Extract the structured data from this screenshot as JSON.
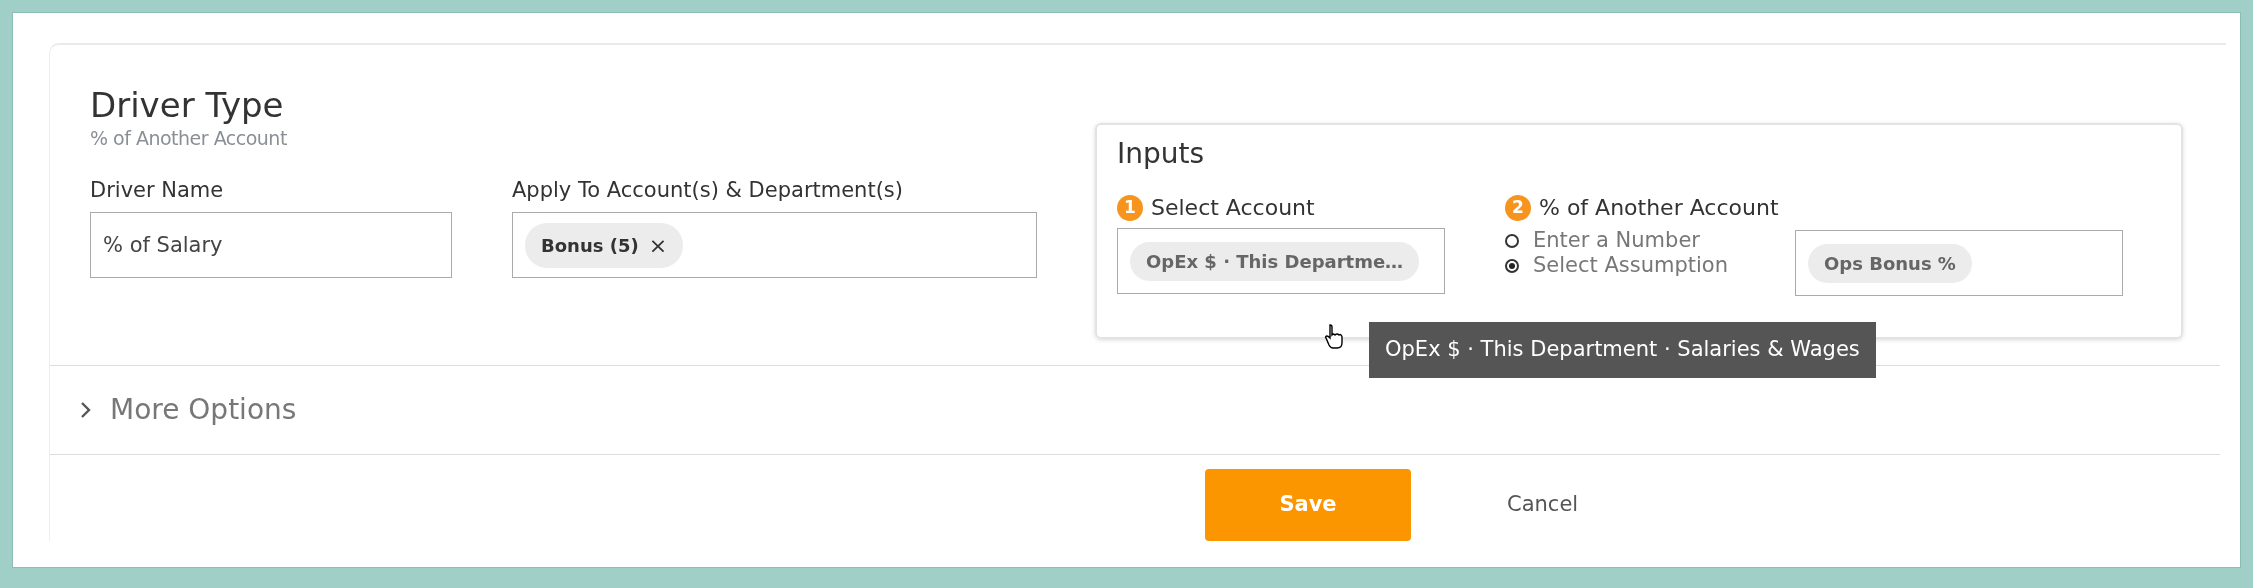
{
  "driver_type": {
    "title": "Driver Type",
    "subtitle": "% of Another Account"
  },
  "driver_name": {
    "label": "Driver Name",
    "value": "% of Salary"
  },
  "apply_to": {
    "label": "Apply To Account(s) & Department(s)",
    "chips": [
      {
        "text": "Bonus (5)",
        "remove": "×"
      }
    ]
  },
  "inputs": {
    "title": "Inputs",
    "select_account": {
      "number": "1",
      "label": "Select Account",
      "chip": "OpEx $ · This Departme…"
    },
    "percent_account": {
      "number": "2",
      "label": "% of Another Account",
      "options": [
        {
          "label": "Enter a Number",
          "selected": false
        },
        {
          "label": "Select Assumption",
          "selected": true
        }
      ],
      "chip": "Ops Bonus %"
    }
  },
  "tooltip": "OpEx $ · This Department · Salaries & Wages",
  "more_options": {
    "label": "More Options",
    "expanded": false
  },
  "buttons": {
    "save": "Save",
    "cancel": "Cancel"
  }
}
